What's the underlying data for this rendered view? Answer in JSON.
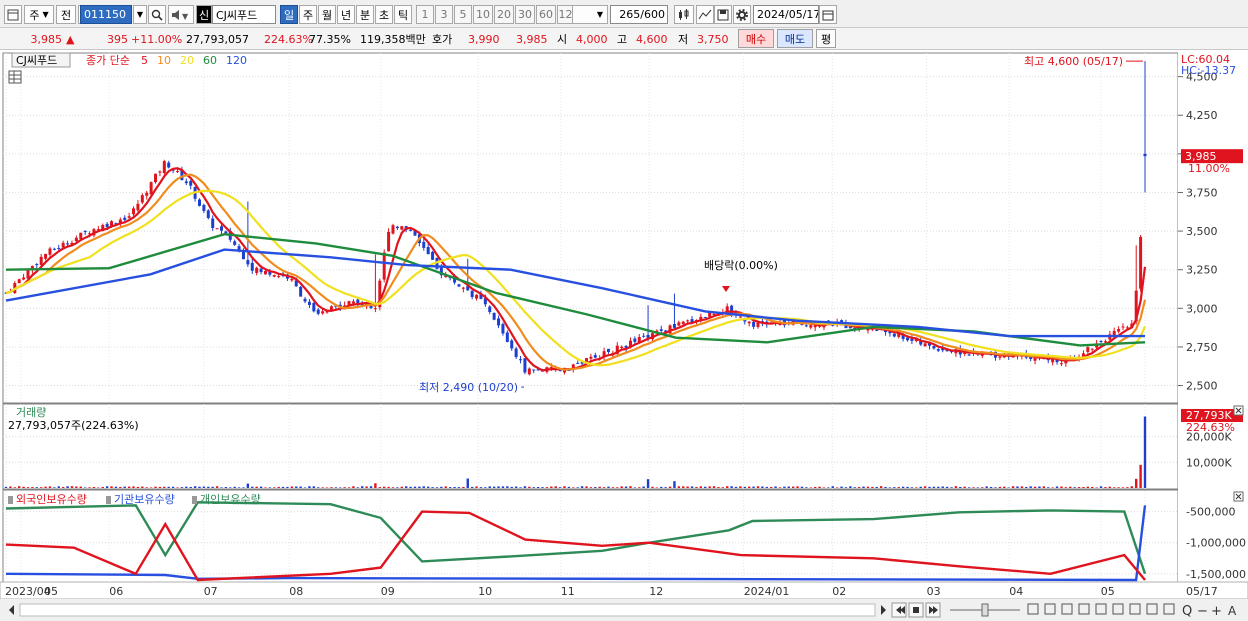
{
  "toolbar": {
    "type_label": "주",
    "prev_label": "전",
    "code": "011150",
    "name_badge": "신",
    "name": "CJ씨푸드",
    "periods": [
      "일",
      "주",
      "월",
      "년",
      "분",
      "초",
      "틱"
    ],
    "active_period": "일",
    "intervals": [
      "1",
      "3",
      "5",
      "10",
      "20",
      "30",
      "60",
      "120"
    ],
    "count": "265",
    "count_total": "/600",
    "date": "2024/05/17"
  },
  "quote": {
    "price": "3,985",
    "change": "395",
    "change_pct": "+11.00%",
    "volume": "27,793,057",
    "volume_pct": "224.63%",
    "turnover": "77.35%",
    "amount": "119,358백만",
    "ask_label": "호가",
    "ask": "3,990",
    "bid": "3,985",
    "open_label": "시",
    "open": "4,000",
    "high_label": "고",
    "high": "4,600",
    "low_label": "저",
    "low": "3,750",
    "buy_label": "매수",
    "sell_label": "매도",
    "avg_label": "평"
  },
  "price_pane": {
    "legend_name": "CJ씨푸드",
    "legend_type": "종가 단순",
    "ma_periods": [
      "5",
      "10",
      "20",
      "60",
      "120"
    ],
    "ma_colors": [
      "#e0141e",
      "#f08c1e",
      "#f0e01e",
      "#1e8c3c",
      "#2850e0"
    ],
    "lc": "LC:60.04",
    "hc": "HC:-13.37",
    "current_tag": "3,985",
    "current_pct": "11.00%",
    "high_note": "최고 4,600 (05/17)",
    "low_note": "최저 2,490 (10/20)",
    "dividend_note": "배당락(0.00%)",
    "y_ticks": [
      "4,500",
      "4,250",
      "4,000",
      "3,750",
      "3,500",
      "3,250",
      "3,000",
      "2,750",
      "2,500"
    ]
  },
  "volume_pane": {
    "title": "거래량",
    "value": "27,793,057주(224.63%)",
    "tag": "27,793K",
    "tag_pct": "224.63%",
    "y_ticks": [
      "20,000K",
      "10,000K"
    ]
  },
  "holding_pane": {
    "legend": [
      "외국인보유수량",
      "기관보유수량",
      "개인보유수량"
    ],
    "colors": [
      "#e0141e",
      "#2850e0",
      "#2e8b57"
    ],
    "y_ticks": [
      "-500,000",
      "-1,000,000",
      "-1,500,000"
    ]
  },
  "x_axis": {
    "labels": [
      "2023/04",
      "05",
      "06",
      "07",
      "08",
      "09",
      "10",
      "11",
      "12",
      "2024/01",
      "02",
      "03",
      "04",
      "05",
      "05/17"
    ]
  },
  "chart_data": {
    "type": "candlestick",
    "price_ylim": [
      2400,
      4640
    ],
    "price_series": [
      {
        "name": "종가 단순 5",
        "period": 5
      },
      {
        "name": "10",
        "period": 10
      },
      {
        "name": "20",
        "period": 20
      },
      {
        "name": "60",
        "period": 60
      },
      {
        "name": "120",
        "period": 120
      }
    ],
    "close_path": [
      [
        "2023/04/27",
        3100
      ],
      [
        "2023/05/10",
        3350
      ],
      [
        "2023/05/25",
        3500
      ],
      [
        "2023/06/08",
        3600
      ],
      [
        "2023/06/20",
        3950
      ],
      [
        "2023/06/28",
        3800
      ],
      [
        "2023/07/05",
        3550
      ],
      [
        "2023/07/12",
        3450
      ],
      [
        "2023/07/20",
        3250
      ],
      [
        "2023/08/01",
        3200
      ],
      [
        "2023/08/10",
        2950
      ],
      [
        "2023/08/22",
        3050
      ],
      [
        "2023/08/30",
        3000
      ],
      [
        "2023/09/04",
        3550
      ],
      [
        "2023/09/12",
        3500
      ],
      [
        "2023/09/20",
        3250
      ],
      [
        "2023/10/05",
        3050
      ],
      [
        "2023/10/12",
        2850
      ],
      [
        "2023/10/20",
        2600
      ],
      [
        "2023/11/01",
        2600
      ],
      [
        "2023/11/15",
        2700
      ],
      [
        "2023/11/28",
        2800
      ],
      [
        "2023/12/12",
        2900
      ],
      [
        "2023/12/27",
        3000
      ],
      [
        "2024/01/05",
        2900
      ],
      [
        "2024/02/01",
        2900
      ],
      [
        "2024/02/20",
        2850
      ],
      [
        "2024/03/05",
        2750
      ],
      [
        "2024/03/20",
        2700
      ],
      [
        "2024/04/05",
        2700
      ],
      [
        "2024/04/20",
        2650
      ],
      [
        "2024/05/03",
        2800
      ],
      [
        "2024/05/13",
        2900
      ],
      [
        "2024/05/16",
        3590
      ],
      [
        "2024/05/17",
        3985
      ]
    ],
    "ma120_path": [
      [
        "2023/04/27",
        3050
      ],
      [
        "2023/06/15",
        3220
      ],
      [
        "2023/07/10",
        3380
      ],
      [
        "2023/08/15",
        3330
      ],
      [
        "2023/09/10",
        3280
      ],
      [
        "2023/10/15",
        3250
      ],
      [
        "2023/11/15",
        3130
      ],
      [
        "2023/12/20",
        2980
      ],
      [
        "2024/01/20",
        2920
      ],
      [
        "2024/03/01",
        2880
      ],
      [
        "2024/04/01",
        2820
      ],
      [
        "2024/05/17",
        2820
      ]
    ],
    "ma60_path": [
      [
        "2023/04/27",
        3250
      ],
      [
        "2023/06/01",
        3260
      ],
      [
        "2023/07/10",
        3480
      ],
      [
        "2023/08/10",
        3420
      ],
      [
        "2023/09/05",
        3340
      ],
      [
        "2023/10/10",
        3100
      ],
      [
        "2023/11/10",
        2960
      ],
      [
        "2023/12/10",
        2810
      ],
      [
        "2024/01/10",
        2780
      ],
      [
        "2024/02/15",
        2880
      ],
      [
        "2024/03/20",
        2850
      ],
      [
        "2024/04/25",
        2760
      ],
      [
        "2024/05/17",
        2780
      ]
    ],
    "dividend_date": "2023/12/27",
    "high_point": {
      "date": "2024/05/17",
      "value": 4600
    },
    "low_point": {
      "date": "2023/10/20",
      "value": 2490
    },
    "volume_last": 27793057,
    "volume_ylim": [
      0,
      28000000
    ],
    "holding": {
      "ylim": [
        -1600000,
        -200000
      ],
      "foreign": [
        [
          "2023/04/27",
          -1030000
        ],
        [
          "2023/05/20",
          -1080000
        ],
        [
          "2023/06/10",
          -1500000
        ],
        [
          "2023/06/20",
          -700000
        ],
        [
          "2023/07/01",
          -1600000
        ],
        [
          "2023/08/15",
          -1500000
        ],
        [
          "2023/09/01",
          -1400000
        ],
        [
          "2023/09/15",
          -500000
        ],
        [
          "2023/10/01",
          -520000
        ],
        [
          "2023/10/20",
          -950000
        ],
        [
          "2023/11/15",
          -1050000
        ],
        [
          "2023/12/01",
          -1000000
        ],
        [
          "2024/01/01",
          -1200000
        ],
        [
          "2024/02/15",
          -1250000
        ],
        [
          "2024/03/15",
          -1380000
        ],
        [
          "2024/04/15",
          -1500000
        ],
        [
          "2024/05/10",
          -1200000
        ],
        [
          "2024/05/17",
          -1600000
        ]
      ],
      "institution": [
        [
          "2023/04/27",
          -1500000
        ],
        [
          "2023/06/20",
          -1520000
        ],
        [
          "2023/07/01",
          -1580000
        ],
        [
          "2023/08/01",
          -1570000
        ],
        [
          "2024/05/14",
          -1600000
        ],
        [
          "2024/05/16",
          -800000
        ],
        [
          "2024/05/17",
          -400000
        ]
      ],
      "individual": [
        [
          "2023/04/27",
          -450000
        ],
        [
          "2023/06/10",
          -400000
        ],
        [
          "2023/06/20",
          -1200000
        ],
        [
          "2023/07/01",
          -350000
        ],
        [
          "2023/08/15",
          -380000
        ],
        [
          "2023/09/01",
          -600000
        ],
        [
          "2023/09/15",
          -1300000
        ],
        [
          "2023/10/15",
          -1220000
        ],
        [
          "2023/11/15",
          -1130000
        ],
        [
          "2023/12/01",
          -1000000
        ],
        [
          "2023/12/28",
          -800000
        ],
        [
          "2024/01/05",
          -650000
        ],
        [
          "2024/02/15",
          -620000
        ],
        [
          "2024/03/15",
          -510000
        ],
        [
          "2024/04/15",
          -480000
        ],
        [
          "2024/05/10",
          -500000
        ],
        [
          "2024/05/17",
          -1500000
        ]
      ]
    }
  }
}
